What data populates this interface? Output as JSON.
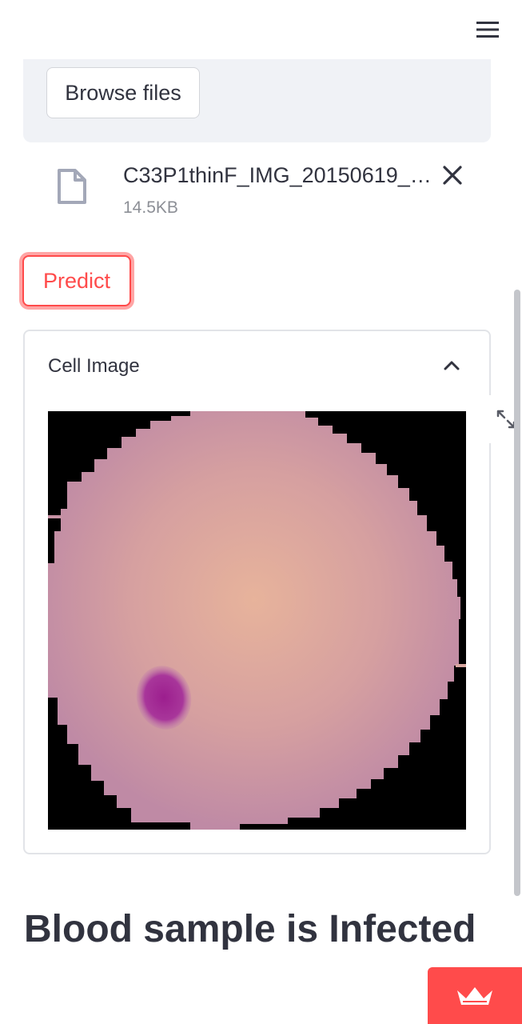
{
  "header": {
    "menu_icon": "hamburger-menu-icon"
  },
  "uploader": {
    "browse_label": "Browse files",
    "file": {
      "icon": "file-icon",
      "name": "C33P1thinF_IMG_20150619_1…",
      "size": "14.5KB",
      "remove_icon": "close-icon"
    }
  },
  "actions": {
    "predict_label": "Predict"
  },
  "expander": {
    "title": "Cell Image",
    "toggle_icon": "chevron-up-icon",
    "fullscreen_icon": "fullscreen-icon"
  },
  "result": {
    "heading": "Blood sample is Infected"
  },
  "colors": {
    "accent": "#ff4b4b",
    "text": "#31333f",
    "muted": "#8c8f96",
    "dropzone_bg": "#f0f2f6"
  },
  "badge_icon": "streamlit-crown-icon"
}
